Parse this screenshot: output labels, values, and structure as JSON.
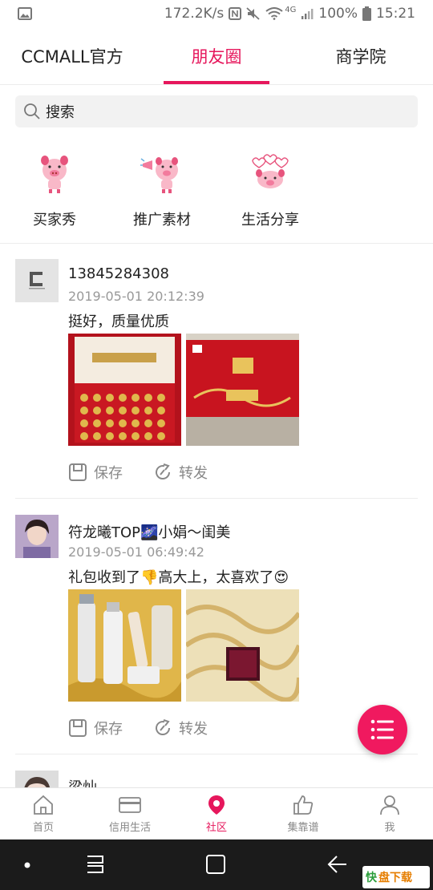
{
  "status_bar": {
    "speed": "172.2K/s",
    "network": "4G",
    "battery": "100%",
    "time": "15:21"
  },
  "tabs": [
    {
      "label": "CCMALL官方",
      "active": false
    },
    {
      "label": "朋友圈",
      "active": true
    },
    {
      "label": "商学院",
      "active": false
    }
  ],
  "search": {
    "placeholder": "搜索"
  },
  "categories": [
    {
      "label": "买家秀",
      "icon": "pig-mascot-icon"
    },
    {
      "label": "推广素材",
      "icon": "pig-megaphone-icon"
    },
    {
      "label": "生活分享",
      "icon": "pig-hearts-icon"
    }
  ],
  "posts": [
    {
      "user": "13845284308",
      "time": "2019-05-01 20:12:39",
      "text": "挺好，质量优质",
      "save_label": "保存",
      "share_label": "转发"
    },
    {
      "user": "符龙曦TOP🌌小娟〜闺美",
      "time": "2019-05-01 06:49:42",
      "text": "礼包收到了👎高大上，太喜欢了😍",
      "save_label": "保存",
      "share_label": "转发"
    },
    {
      "user": "梁灿"
    }
  ],
  "bottom_nav": [
    {
      "label": "首页",
      "icon": "home-icon",
      "active": false
    },
    {
      "label": "信用生活",
      "icon": "card-icon",
      "active": false
    },
    {
      "label": "社区",
      "icon": "location-pin-icon",
      "active": true
    },
    {
      "label": "集靠谱",
      "icon": "thumbs-up-icon",
      "active": false
    },
    {
      "label": "我",
      "icon": "person-icon",
      "active": false
    }
  ],
  "watermark": {
    "prefix": "快",
    "text": "盘下载"
  },
  "colors": {
    "accent": "#e6175c",
    "fab": "#f0195f"
  }
}
